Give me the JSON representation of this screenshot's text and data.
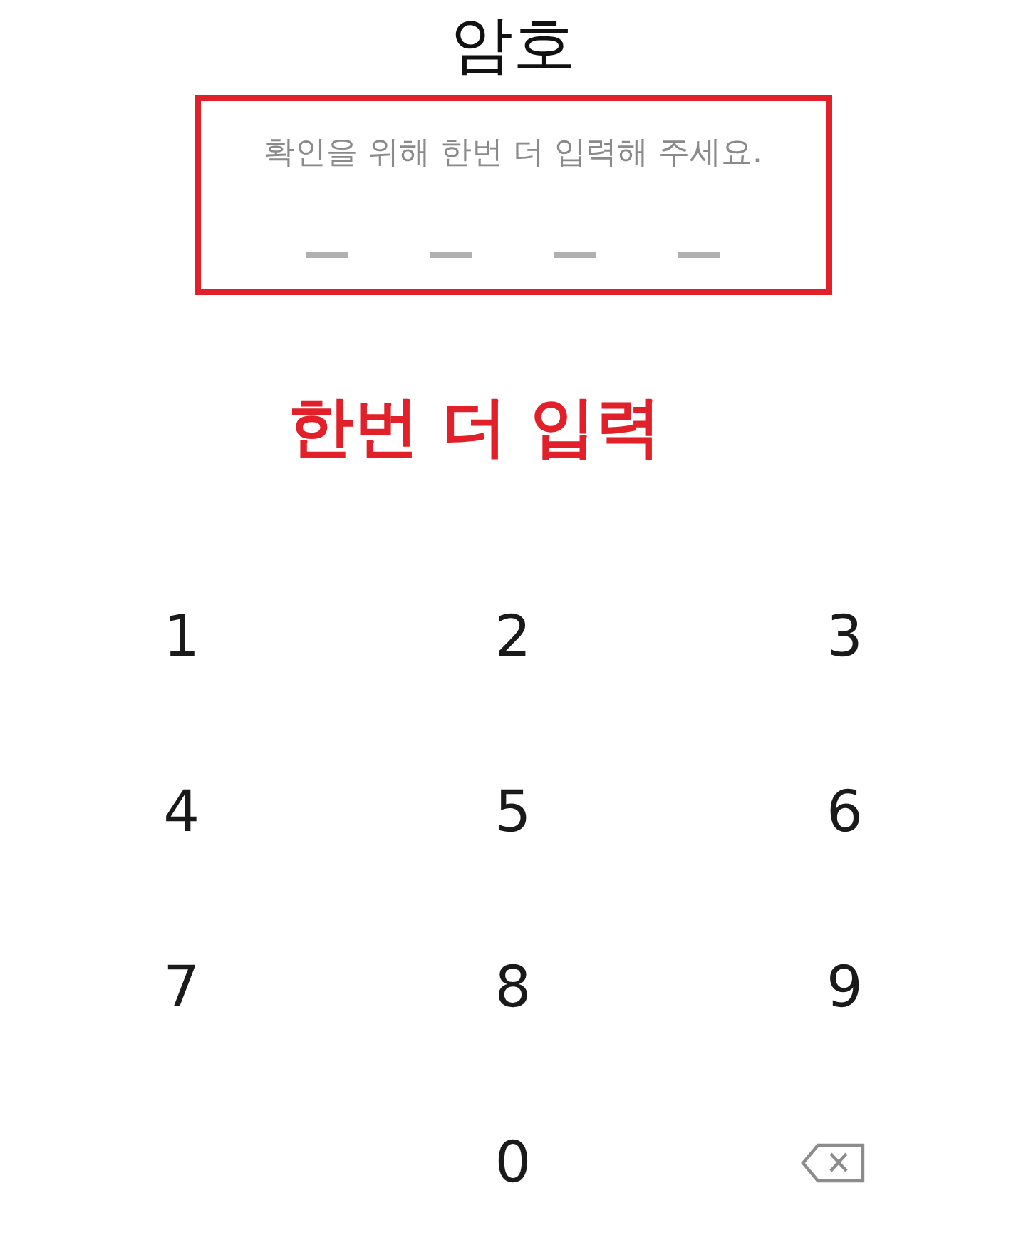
{
  "title": "암호",
  "pin_entry": {
    "highlighted": true,
    "hint": "확인을 위해 한번 더 입력해 주세요.",
    "slots": [
      {
        "filled": false
      },
      {
        "filled": false
      },
      {
        "filled": false
      },
      {
        "filled": false
      }
    ]
  },
  "annotation": "한번 더 입력",
  "keypad": {
    "keys": [
      {
        "kind": "digit",
        "label": "1"
      },
      {
        "kind": "digit",
        "label": "2"
      },
      {
        "kind": "digit",
        "label": "3"
      },
      {
        "kind": "digit",
        "label": "4"
      },
      {
        "kind": "digit",
        "label": "5"
      },
      {
        "kind": "digit",
        "label": "6"
      },
      {
        "kind": "digit",
        "label": "7"
      },
      {
        "kind": "digit",
        "label": "8"
      },
      {
        "kind": "digit",
        "label": "9"
      },
      {
        "kind": "blank"
      },
      {
        "kind": "digit",
        "label": "0"
      },
      {
        "kind": "backspace"
      }
    ]
  }
}
